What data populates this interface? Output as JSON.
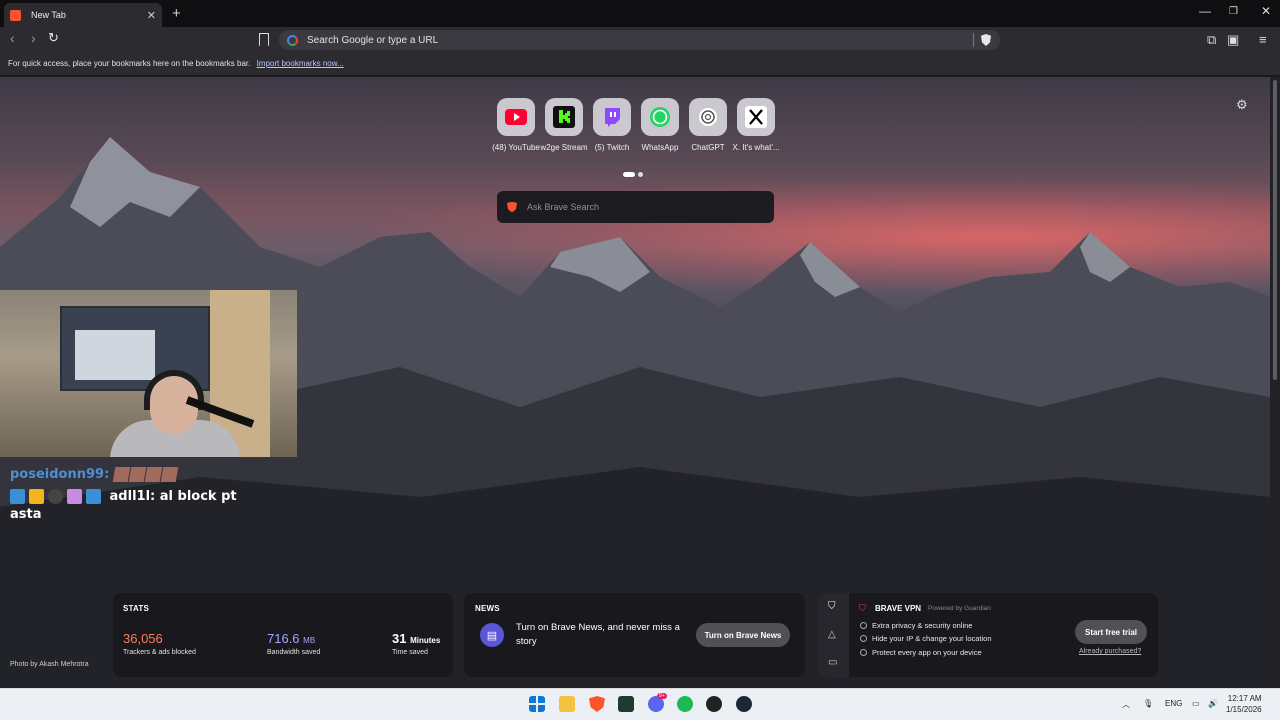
{
  "browser": {
    "tab_title": "New Tab",
    "omnibox_placeholder": "Search Google or type a URL",
    "bookmarks_bar_text": "For quick access, place your bookmarks here on the bookmarks bar.",
    "import_bookmarks_link": "Import bookmarks now..."
  },
  "top_sites": [
    {
      "label": "(48) YouTube",
      "icon": "youtube-icon",
      "color": "#ff0033"
    },
    {
      "label": "w2ge Stream",
      "icon": "kick-icon",
      "color": "#53fc18"
    },
    {
      "label": "(5) Twitch",
      "icon": "twitch-icon",
      "color": "#9146ff"
    },
    {
      "label": "WhatsApp",
      "icon": "whatsapp-icon",
      "color": "#25d366"
    },
    {
      "label": "ChatGPT",
      "icon": "chatgpt-icon",
      "color": "#ffffff"
    },
    {
      "label": "X. It's what'...",
      "icon": "x-icon",
      "color": "#000000"
    }
  ],
  "search": {
    "placeholder": "Ask Brave Search"
  },
  "chat": {
    "line1_user": "poseidonn99:",
    "line2_user": "adll1l:",
    "line2_text": "al block pt",
    "line3_text": "asta"
  },
  "stats": {
    "title": "STATS",
    "trackers_value": "36,056",
    "trackers_label": "Trackers & ads blocked",
    "bandwidth_value": "716.6",
    "bandwidth_unit": "MB",
    "bandwidth_label": "Bandwidth saved",
    "time_value": "31",
    "time_unit": "Minutes",
    "time_label": "Time saved"
  },
  "news": {
    "title": "NEWS",
    "text": "Turn on Brave News, and never miss a story",
    "button": "Turn on Brave News"
  },
  "vpn": {
    "title": "BRAVE VPN",
    "powered_by": "Powered by",
    "partner": "Guardian",
    "features": [
      "Extra privacy & security online",
      "Hide your IP & change your location",
      "Protect every app on your device"
    ],
    "button": "Start free trial",
    "link": "Already purchased?"
  },
  "photo_credit": "Photo by Akash Mehrotra",
  "taskbar": {
    "lang": "ENG",
    "time": "12:17 AM",
    "date": "1/15/2026",
    "notif_badge": "9+"
  },
  "colors": {
    "stats_orange": "#ff7b5a",
    "stats_purple": "#a3a6ff",
    "brave_orange": "#fb542b"
  }
}
